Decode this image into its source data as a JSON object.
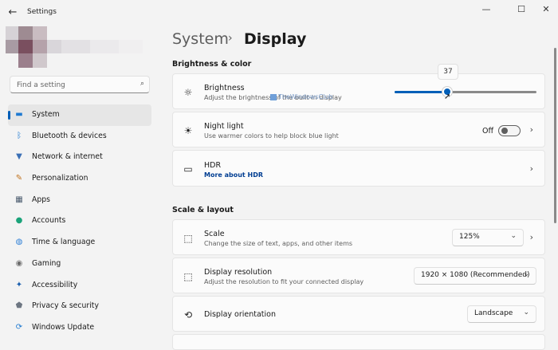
{
  "window": {
    "title": "Settings",
    "back_glyph": "←",
    "minimize_glyph": "—",
    "maximize_glyph": "☐",
    "close_glyph": "✕"
  },
  "search": {
    "placeholder": "Find a setting",
    "icon": "search-icon",
    "icon_glyph": "⌕"
  },
  "sidebar": {
    "active_color": "#005fb8",
    "items": [
      {
        "label": "System",
        "icon": "monitor-icon",
        "glyph": "▬",
        "color": "#1f7ad1"
      },
      {
        "label": "Bluetooth & devices",
        "icon": "bluetooth-icon",
        "glyph": "ᛒ",
        "color": "#1f7ad1"
      },
      {
        "label": "Network & internet",
        "icon": "wifi-icon",
        "glyph": "▼",
        "color": "#3a6fb5"
      },
      {
        "label": "Personalization",
        "icon": "brush-icon",
        "glyph": "✎",
        "color": "#c0721e"
      },
      {
        "label": "Apps",
        "icon": "apps-icon",
        "glyph": "▦",
        "color": "#4b5b6e"
      },
      {
        "label": "Accounts",
        "icon": "person-icon",
        "glyph": "●",
        "color": "#1ba37a"
      },
      {
        "label": "Time & language",
        "icon": "globe-icon",
        "glyph": "◍",
        "color": "#2d7fd6"
      },
      {
        "label": "Gaming",
        "icon": "gamepad-icon",
        "glyph": "◉",
        "color": "#6b6b6b"
      },
      {
        "label": "Accessibility",
        "icon": "accessibility-icon",
        "glyph": "✦",
        "color": "#1b5fae"
      },
      {
        "label": "Privacy & security",
        "icon": "shield-icon",
        "glyph": "⬟",
        "color": "#6d7682"
      },
      {
        "label": "Windows Update",
        "icon": "update-icon",
        "glyph": "⟳",
        "color": "#1f7ad1"
      }
    ]
  },
  "breadcrumb": {
    "parent": "System",
    "separator": "›",
    "current": "Display"
  },
  "sections": {
    "brightness_color": "Brightness & color",
    "scale_layout": "Scale & layout"
  },
  "brightness": {
    "icon": "sun-icon",
    "glyph": "☼",
    "title": "Brightness",
    "subtitle": "Adjust the brightness of the built-in display",
    "value": 37,
    "value_label": "37",
    "max": 100,
    "cursor_glyph": "➚"
  },
  "watermark": {
    "text": "TheWindowsClub"
  },
  "night_light": {
    "icon": "night-light-icon",
    "glyph": "☀",
    "title": "Night light",
    "subtitle": "Use warmer colors to help block blue light",
    "state_label": "Off",
    "chevron": "›"
  },
  "hdr": {
    "icon": "hdr-icon",
    "glyph": "▭",
    "title": "HDR",
    "link": "More about HDR",
    "chevron": "›"
  },
  "scale": {
    "icon": "scale-icon",
    "glyph": "⬚",
    "title": "Scale",
    "subtitle": "Change the size of text, apps, and other items",
    "value": "125%",
    "chevron": "›",
    "dropdown_glyph": "⌄"
  },
  "resolution": {
    "icon": "resolution-icon",
    "glyph": "⬚",
    "title": "Display resolution",
    "subtitle": "Adjust the resolution to fit your connected display",
    "value": "1920 × 1080 (Recommended)",
    "dropdown_glyph": "⌄"
  },
  "orientation": {
    "icon": "orientation-icon",
    "glyph": "⟲",
    "title": "Display orientation",
    "value": "Landscape",
    "dropdown_glyph": "⌄"
  }
}
